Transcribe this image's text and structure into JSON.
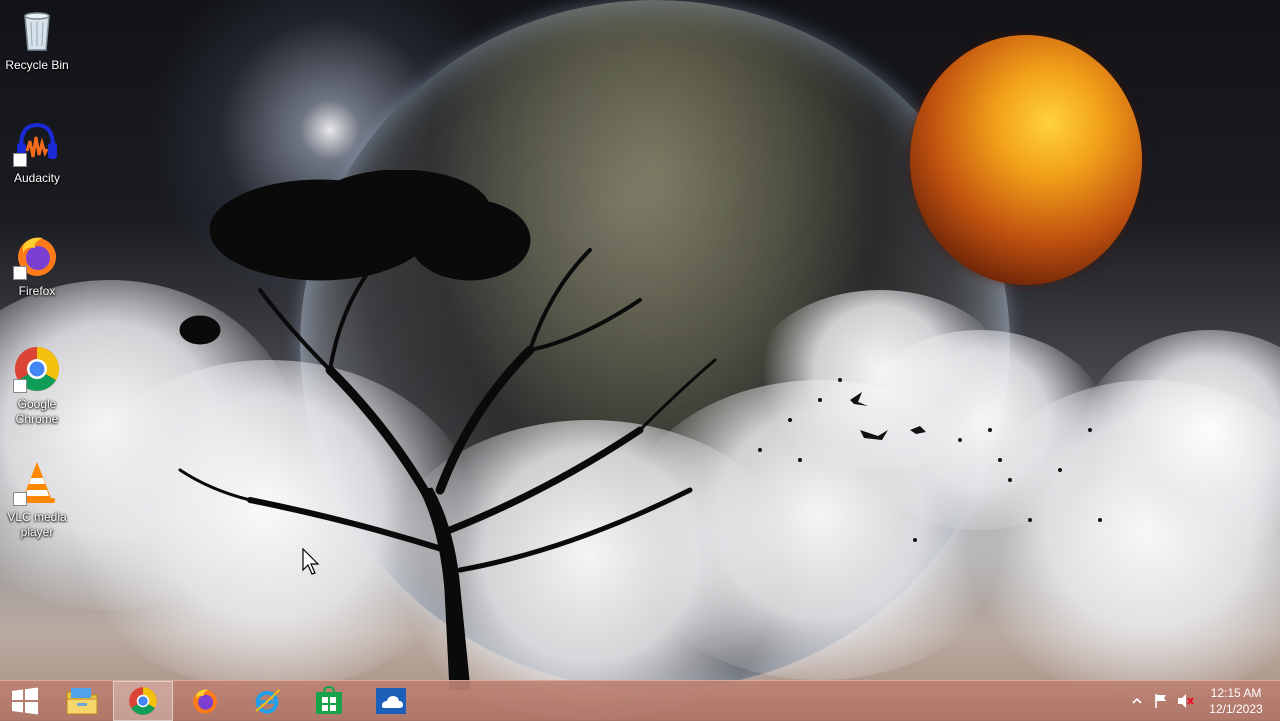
{
  "desktop": {
    "icons": [
      {
        "label": "Recycle Bin",
        "icon": "recycle-bin-icon"
      },
      {
        "label": "Audacity",
        "icon": "audacity-icon"
      },
      {
        "label": "Firefox",
        "icon": "firefox-icon"
      },
      {
        "label": "Google Chrome",
        "icon": "chrome-icon"
      },
      {
        "label": "VLC media player",
        "icon": "vlc-icon"
      }
    ]
  },
  "taskbar": {
    "start": "windows-start-icon",
    "pinned": [
      {
        "name": "file-explorer",
        "icon": "file-explorer-icon"
      },
      {
        "name": "google-chrome",
        "icon": "chrome-icon",
        "active": true
      },
      {
        "name": "firefox",
        "icon": "firefox-icon"
      },
      {
        "name": "internet-explorer",
        "icon": "internet-explorer-icon"
      },
      {
        "name": "store",
        "icon": "store-icon"
      },
      {
        "name": "onedrive",
        "icon": "onedrive-icon"
      }
    ],
    "tray": {
      "show_hidden": "chevron-up-icon",
      "flag": "action-center-flag-icon",
      "volume": "volume-muted-icon"
    },
    "clock": {
      "time": "12:15 AM",
      "date": "12/1/2023"
    }
  },
  "colors": {
    "taskbar": "#b5786a",
    "accent_chrome_red": "#db4437",
    "accent_chrome_yellow": "#f4c20d",
    "accent_chrome_green": "#0f9d58",
    "accent_chrome_blue": "#4285f4"
  }
}
